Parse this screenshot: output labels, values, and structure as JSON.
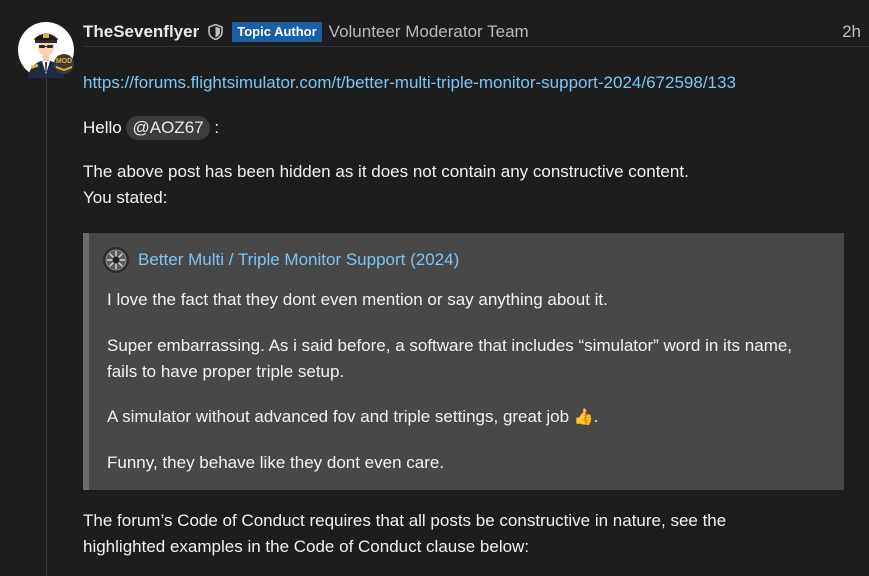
{
  "post": {
    "username": "TheSevenflyer",
    "topic_badge": "Topic Author",
    "team": "Volunteer Moderator Team",
    "time": "2h",
    "mod_label": "MOD",
    "link": "https://forums.flightsimulator.com/t/better-multi-triple-monitor-support-2024/672598/133",
    "greeting": "Hello",
    "mention": "@AOZ67",
    "greeting_end": ":",
    "hidden_line": "The above post has been hidden as it does not contain any constructive content.",
    "stated_line": "You stated:",
    "conduct_line1": "The forum’s Code of Conduct requires that all posts be constructive in nature, see the",
    "conduct_line2": "highlighted examples in the Code of Conduct clause below:"
  },
  "quote": {
    "title": "Better Multi / Triple Monitor Support (2024)",
    "p1": "I love the fact that they dont even mention or say anything about it.",
    "p2_line1": "Super embarrassing. As i said before, a software that includes “simulator” word in its name,",
    "p2_line2": "fails to have proper triple setup.",
    "p3": "A simulator without advanced fov and triple settings, great job",
    "p3_emoji": "👍",
    "p3_end": ".",
    "p4": "Funny, they behave like they dont even care."
  },
  "colors": {
    "background": "#1d1d1d",
    "link": "#7ec4f5",
    "badge": "#1a5fa3",
    "quote_bg": "#484848"
  },
  "icons": [
    "avatar-pilot",
    "mod-badge-icon",
    "shield-icon",
    "quote-avatar-icon",
    "thumbs-up-emoji"
  ]
}
